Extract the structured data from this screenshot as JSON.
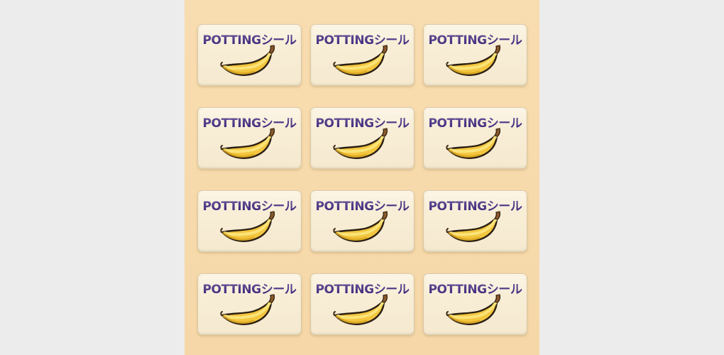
{
  "stickers": {
    "label": "POTTINGシール",
    "icon": "banana-icon",
    "rows": 4,
    "columns": 3
  },
  "colors": {
    "background": "#ececec",
    "sheet": "#f7dbad",
    "label_text": "#3b247a",
    "banana_yellow": "#f6d24b"
  }
}
